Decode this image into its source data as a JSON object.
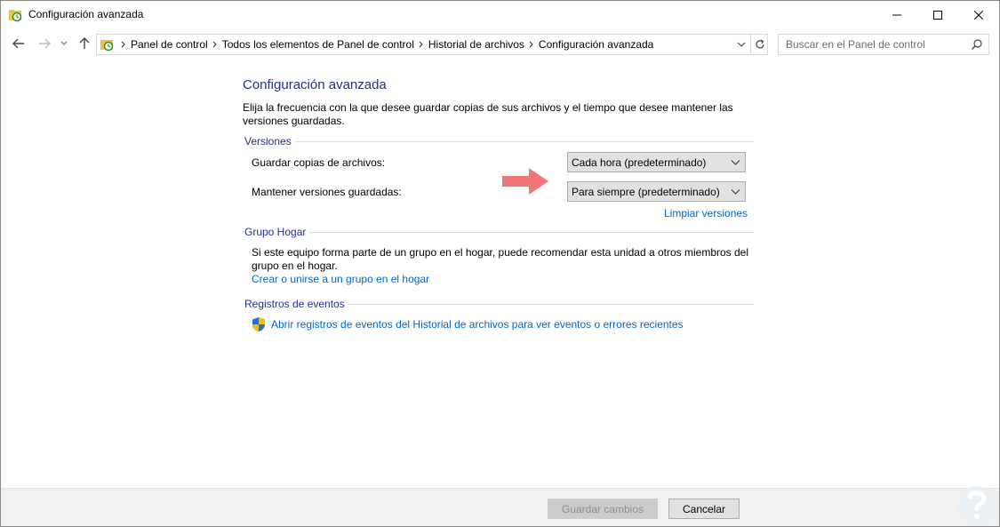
{
  "window": {
    "title": "Configuración avanzada",
    "controls": {
      "minimize_icon": "minimize-icon",
      "maximize_icon": "maximize-icon",
      "close_icon": "close-icon"
    }
  },
  "navigation": {
    "breadcrumbs": [
      "Panel de control",
      "Todos los elementos de Panel de control",
      "Historial de archivos",
      "Configuración avanzada"
    ],
    "search_placeholder": "Buscar en el Panel de control"
  },
  "page": {
    "title": "Configuración avanzada",
    "description": "Elija la frecuencia con la que desee guardar copias de sus archivos y el tiempo que desee mantener las versiones guardadas."
  },
  "versions": {
    "label": "Versiones",
    "save_copies_label": "Guardar copias de archivos:",
    "save_copies_value": "Cada hora (predeterminado)",
    "keep_versions_label": "Mantener versiones guardadas:",
    "keep_versions_value": "Para siempre (predeterminado)",
    "cleanup_link": "Limpiar versiones"
  },
  "homegroup": {
    "label": "Grupo Hogar",
    "text": "Si este equipo forma parte de un grupo en el hogar, puede recomendar esta unidad a otros miembros del grupo en el hogar.",
    "link": "Crear o unirse a un grupo en el hogar"
  },
  "events": {
    "label": "Registros de eventos",
    "link": "Abrir registros de eventos del Historial de archivos para ver eventos o errores recientes"
  },
  "footer": {
    "save_label": "Guardar cambios",
    "cancel_label": "Cancelar"
  },
  "colors": {
    "heading": "#1e3287",
    "link": "#0066cc",
    "arrow": "#f06a6a"
  }
}
